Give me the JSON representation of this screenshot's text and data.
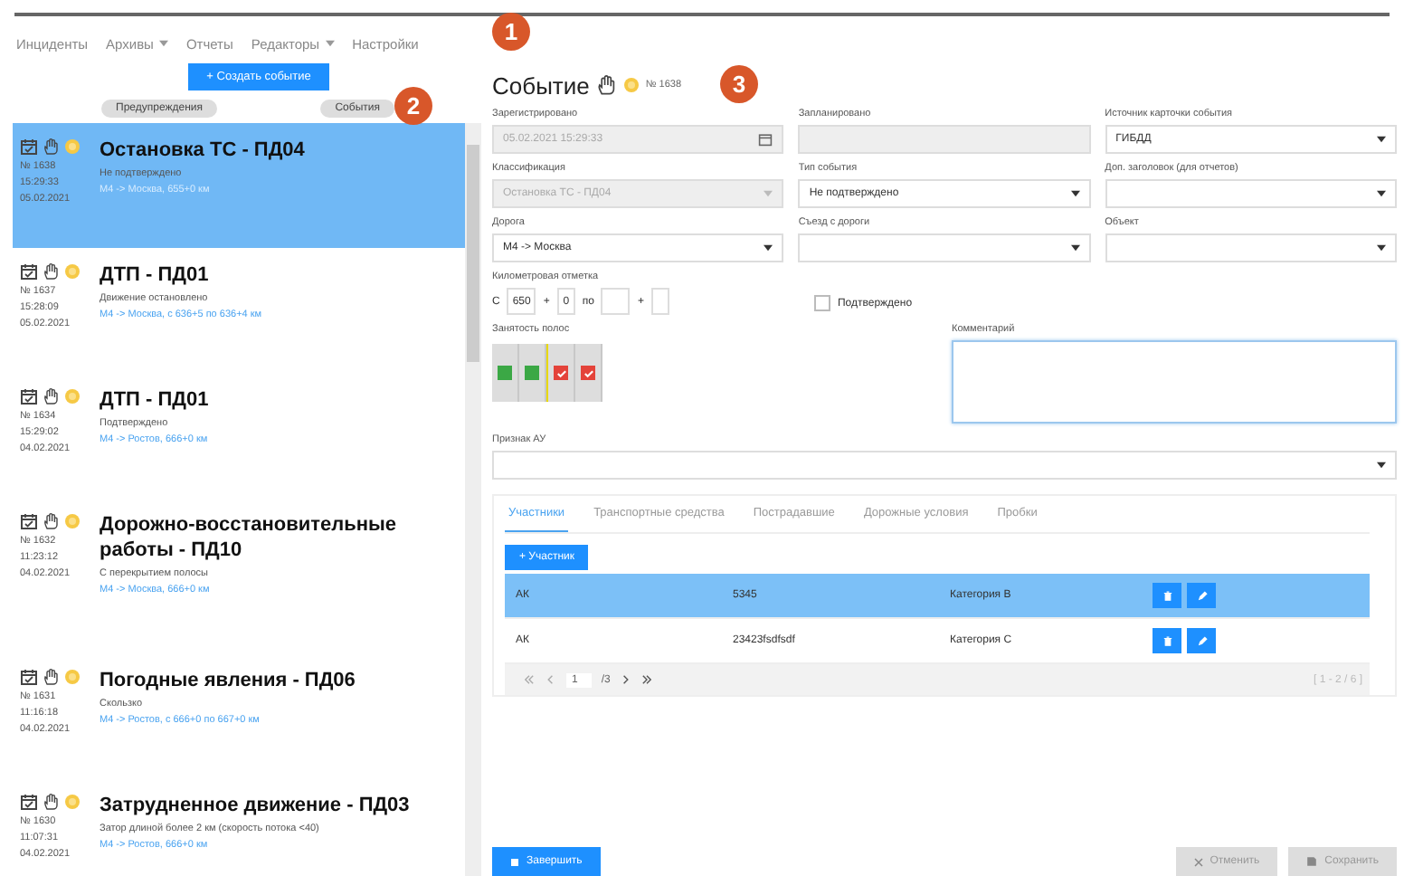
{
  "nav": {
    "items": [
      {
        "label": "Инциденты",
        "dropdown": false
      },
      {
        "label": "Архивы",
        "dropdown": true
      },
      {
        "label": "Отчеты",
        "dropdown": false
      },
      {
        "label": "Редакторы",
        "dropdown": true
      },
      {
        "label": "Настройки",
        "dropdown": false
      }
    ]
  },
  "sidebar": {
    "create_button": "+ Создать событие",
    "filters": [
      "Предупреждения",
      "События"
    ],
    "events": [
      {
        "title": "Остановка ТС - ПД04",
        "number": "№ 1638",
        "time": "15:29:33",
        "date": "05.02.2021",
        "status": "Не подтверждено",
        "location": "М4 -> Москва, 655+0 км",
        "selected": true
      },
      {
        "title": "ДТП - ПД01",
        "number": "№ 1637",
        "time": "15:28:09",
        "date": "05.02.2021",
        "status": "Движение остановлено",
        "location": "М4 -> Москва, с 636+5 по 636+4 км",
        "selected": false
      },
      {
        "title": "ДТП - ПД01",
        "number": "№ 1634",
        "time": "15:29:02",
        "date": "04.02.2021",
        "status": "Подтверждено",
        "location": "М4 -> Ростов, 666+0 км",
        "selected": false
      },
      {
        "title": "Дорожно-восстановительные работы - ПД10",
        "number": "№ 1632",
        "time": "11:23:12",
        "date": "04.02.2021",
        "status": "С перекрытием полосы",
        "location": "М4 -> Москва, 666+0 км",
        "selected": false
      },
      {
        "title": "Погодные явления - ПД06",
        "number": "№ 1631",
        "time": "11:16:18",
        "date": "04.02.2021",
        "status": "Скользко",
        "location": "М4 -> Ростов, с 666+0 по 667+0 км",
        "selected": false
      },
      {
        "title": "Затрудненное движение - ПД03",
        "number": "№ 1630",
        "time": "11:07:31",
        "date": "04.02.2021",
        "status": "Затор длиной более 2 км (скорость потока <40)",
        "location": "М4 -> Ростов, 666+0 км",
        "selected": false
      }
    ]
  },
  "event": {
    "title": "Событие",
    "number": "№ 1638",
    "fields": [
      {
        "label": "Зарегистрировано",
        "value": "05.02.2021 15:29:33",
        "kind": "date",
        "disabled": true
      },
      {
        "label": "Запланировано",
        "kind": "text",
        "disabled": true
      },
      {
        "label": "Источник карточки события",
        "value": "ГИБДД",
        "kind": "select",
        "disabled": false
      },
      {
        "label": "Классификация",
        "value": "Остановка ТС - ПД04",
        "kind": "select",
        "disabled": true
      },
      {
        "label": "Тип события",
        "value": "Не подтверждено",
        "kind": "select",
        "disabled": false
      },
      {
        "label": "Доп. заголовок (для отчетов)",
        "kind": "select",
        "disabled": false
      },
      {
        "label": "Дорога",
        "value": "М4 -> Москва",
        "kind": "select",
        "disabled": false
      },
      {
        "label": "Съезд с дороги",
        "kind": "select",
        "disabled": false
      },
      {
        "label": "Объект",
        "kind": "select",
        "disabled": false
      }
    ],
    "km": {
      "label": "Километровая отметка",
      "from_label": "С",
      "plus": "+",
      "to_label": "по",
      "from_km": "650",
      "from_m": "0"
    },
    "confirmed": {
      "label": "Подтверждено",
      "checked": false
    },
    "lanes": {
      "label": "Занятость полос",
      "items": [
        {
          "occupied": false
        },
        {
          "occupied": false
        },
        {
          "occupied": true
        },
        {
          "occupied": true
        }
      ]
    },
    "comment": {
      "label": "Комментарий"
    },
    "au": {
      "label": "Признак АУ"
    },
    "tabs": [
      {
        "label": "Участники",
        "selected": true
      },
      {
        "label": "Транспортные средства",
        "selected": false
      },
      {
        "label": "Пострадавшие",
        "selected": false
      },
      {
        "label": "Дорожные условия",
        "selected": false
      },
      {
        "label": "Пробки",
        "selected": false
      }
    ],
    "add_button": "+ Участник",
    "participants": [
      {
        "cells": [
          "АК",
          "5345",
          "Категория B"
        ],
        "selected": true
      },
      {
        "cells": [
          "АК",
          "23423fsdfsdf",
          "Категория C"
        ],
        "selected": false
      }
    ],
    "pager": {
      "page": "1",
      "of": "/3",
      "range": "[ 1 - 2 / 6 ]"
    },
    "finish_button": "Завершить",
    "cancel_button": "Отменить",
    "save_button": "Сохранить"
  },
  "callouts": [
    "1",
    "2",
    "3"
  ]
}
